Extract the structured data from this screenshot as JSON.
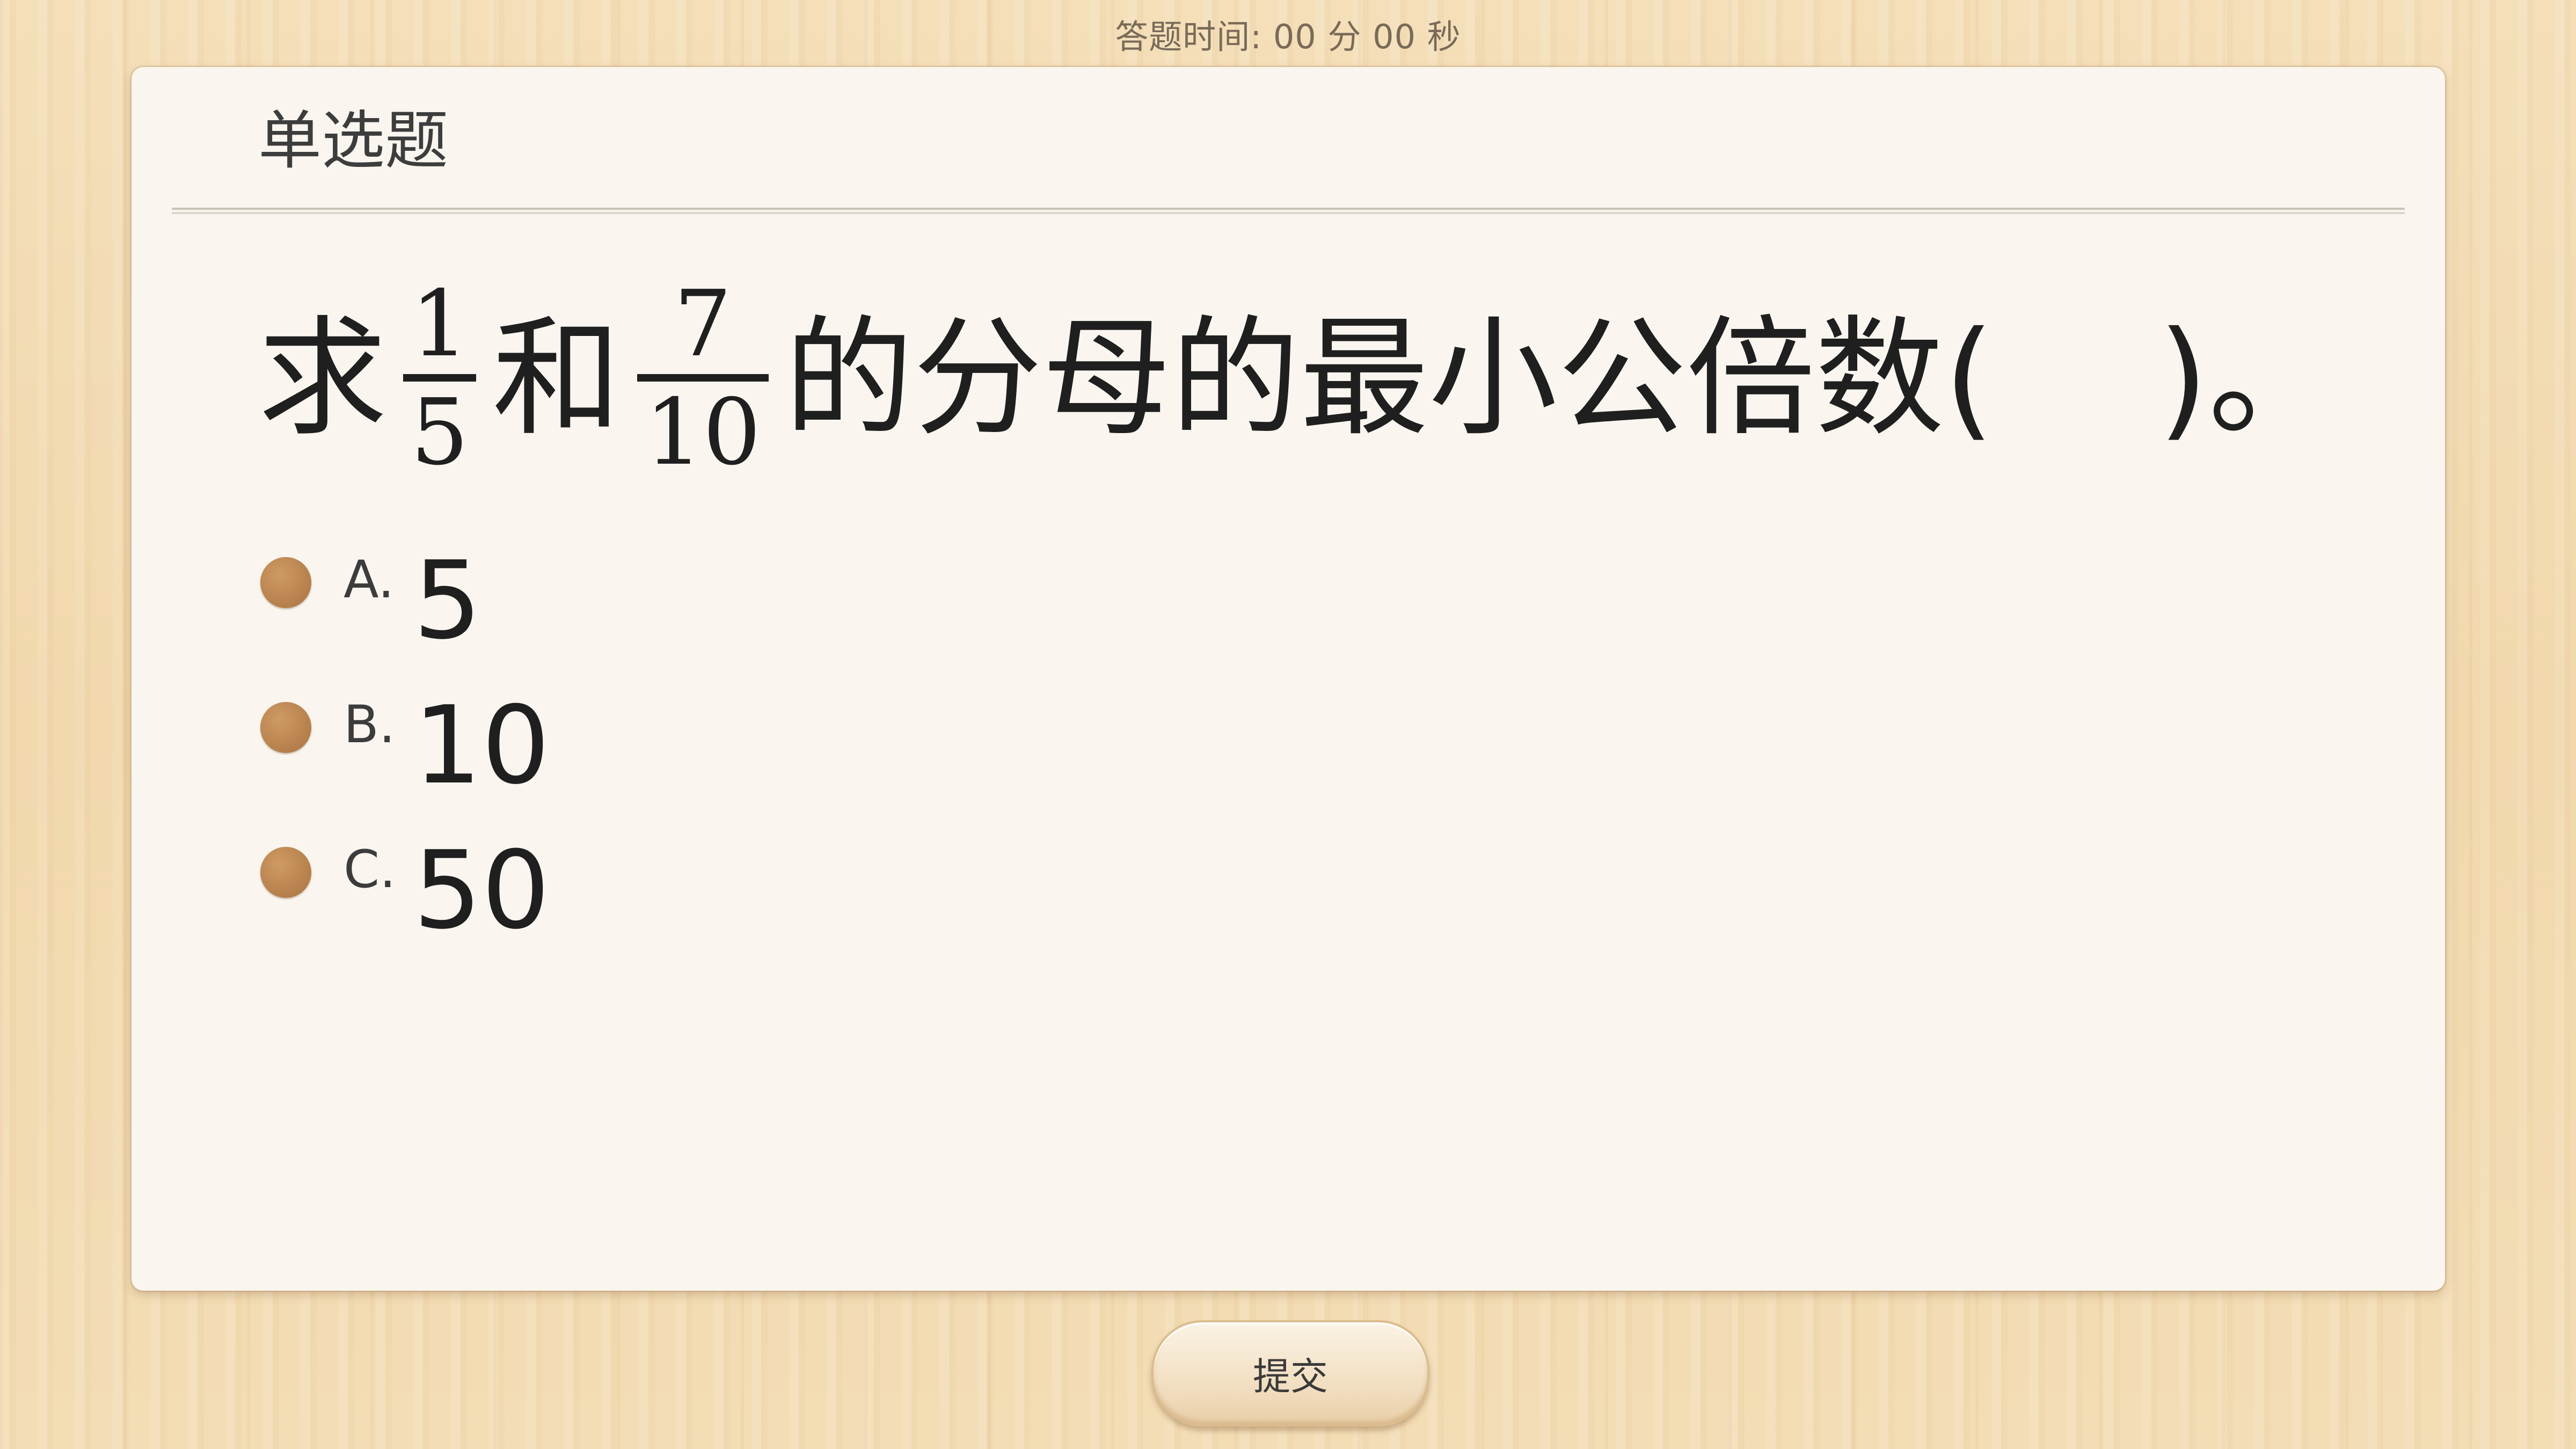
{
  "timer": "答题时间:  00 分 00 秒",
  "question_type": "单选题",
  "question": {
    "prefix": "求",
    "fraction1": {
      "numerator": "1",
      "denominator": "5"
    },
    "connector": "和",
    "fraction2": {
      "numerator": "7",
      "denominator": "10"
    },
    "suffix": "的分母的最小公倍数(    )。"
  },
  "options": [
    {
      "letter": "A.",
      "value": "5"
    },
    {
      "letter": "B.",
      "value": "10"
    },
    {
      "letter": "C.",
      "value": "50"
    }
  ],
  "submit_label": "提交",
  "colors": {
    "radio": "#b57f4c",
    "card": "#faf6ef",
    "background": "#f3dcb4"
  }
}
